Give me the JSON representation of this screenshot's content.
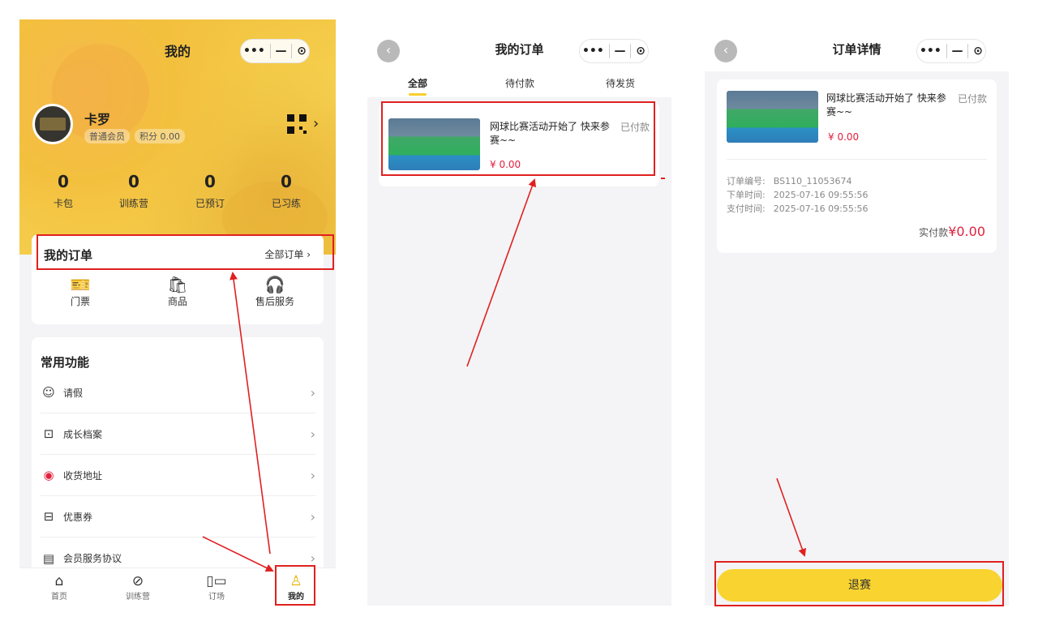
{
  "colors": {
    "accent": "#f9d32f",
    "price": "#e0213d",
    "annotation": "#e02020"
  },
  "screen1": {
    "title": "我的",
    "capsule": {
      "more": "•••",
      "minimize": "—",
      "close": "⊙"
    },
    "user": {
      "name": "卡罗",
      "level": "普通会员",
      "points": "积分 0.00"
    },
    "stats": [
      {
        "value": "0",
        "label": "卡包"
      },
      {
        "value": "0",
        "label": "训练营"
      },
      {
        "value": "0",
        "label": "已预订"
      },
      {
        "value": "0",
        "label": "已习练"
      }
    ],
    "orders": {
      "title": "我的订单",
      "all": "全部订单 ›",
      "items": [
        {
          "label": "门票",
          "icon": "ticket-icon"
        },
        {
          "label": "商品",
          "icon": "bag-icon"
        },
        {
          "label": "售后服务",
          "icon": "headset-icon"
        }
      ]
    },
    "functions": {
      "title": "常用功能",
      "items": [
        {
          "label": "请假",
          "icon": "leave-icon"
        },
        {
          "label": "成长档案",
          "icon": "archive-icon"
        },
        {
          "label": "收货地址",
          "icon": "location-icon"
        },
        {
          "label": "优惠券",
          "icon": "coupon-icon"
        },
        {
          "label": "会员服务协议",
          "icon": "document-icon"
        }
      ]
    },
    "tabbar": [
      {
        "label": "首页",
        "icon": "home-icon"
      },
      {
        "label": "训练营",
        "icon": "ball-icon"
      },
      {
        "label": "订场",
        "icon": "venue-icon"
      },
      {
        "label": "我的",
        "icon": "user-icon"
      }
    ]
  },
  "screen2": {
    "title": "我的订单",
    "tabs": [
      "全部",
      "待付款",
      "待发货"
    ],
    "order": {
      "title": "网球比赛活动开始了 快来参赛~~",
      "status": "已付款",
      "price": "¥ 0.00"
    }
  },
  "screen3": {
    "title": "订单详情",
    "order": {
      "title": "网球比赛活动开始了 快来参赛~~",
      "status": "已付款",
      "price": "¥ 0.00"
    },
    "info": [
      {
        "key": "订单编号:",
        "value": "BS110_11053674"
      },
      {
        "key": "下单时间:",
        "value": "2025-07-16 09:55:56"
      },
      {
        "key": "支付时间:",
        "value": "2025-07-16 09:55:56"
      }
    ],
    "paid_label": "实付款",
    "paid_amount": "¥0.00",
    "refund_button": "退赛"
  }
}
